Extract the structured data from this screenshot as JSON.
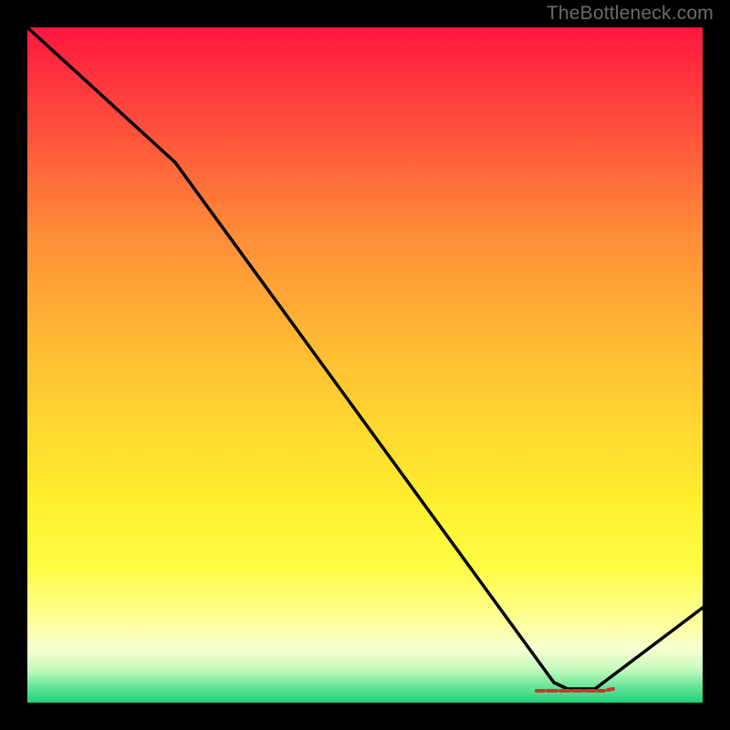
{
  "watermark": "TheBottleneck.com",
  "chart_data": {
    "type": "line",
    "title": "",
    "xlabel": "",
    "ylabel": "",
    "xlim": [
      0,
      100
    ],
    "ylim": [
      0,
      100
    ],
    "grid": false,
    "series": [
      {
        "name": "curve",
        "x": [
          0,
          22,
          78,
          80,
          84,
          100
        ],
        "values": [
          100,
          80,
          3,
          2,
          2,
          14
        ]
      }
    ],
    "markers": [
      {
        "name": "minimum-band",
        "x_start": 78,
        "x_end": 84,
        "y": 2,
        "label": ""
      }
    ],
    "colors": {
      "line": "#000000",
      "marker": "#c23a2a",
      "gradient_top": "#ff153f",
      "gradient_bottom": "#1fd37a"
    }
  }
}
